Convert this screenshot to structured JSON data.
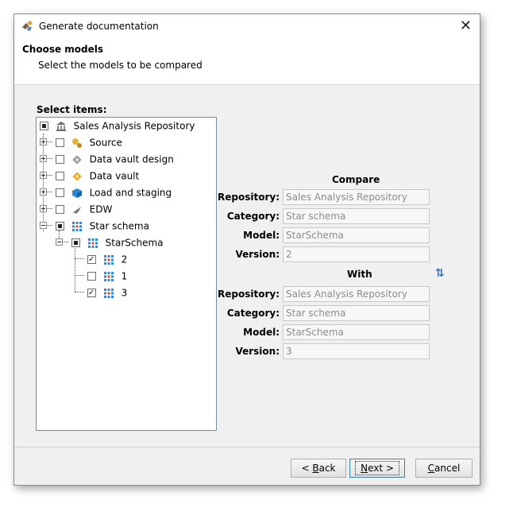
{
  "window": {
    "title": "Generate documentation",
    "close_symbol": "✕"
  },
  "header": {
    "title": "Choose models",
    "subtitle": "Select the models to be compared"
  },
  "tree": {
    "label": "Select items:",
    "root": "Sales Analysis Repository",
    "items": [
      {
        "label": "Source",
        "icon": "source-icon"
      },
      {
        "label": "Data vault design",
        "icon": "data-vault-design-icon"
      },
      {
        "label": "Data vault",
        "icon": "data-vault-icon"
      },
      {
        "label": "Load and staging",
        "icon": "load-staging-icon"
      },
      {
        "label": "EDW",
        "icon": "edw-icon"
      },
      {
        "label": "Star schema",
        "icon": "star-schema-icon"
      }
    ],
    "model": "StarSchema",
    "versions": [
      "2",
      "1",
      "3"
    ]
  },
  "compare": {
    "title": "Compare",
    "repository_label": "Repository:",
    "category_label": "Category:",
    "model_label": "Model:",
    "version_label": "Version:",
    "repository": "Sales Analysis Repository",
    "category": "Star schema",
    "model": "StarSchema",
    "version": "2"
  },
  "with": {
    "title": "With",
    "repository_label": "Repository:",
    "category_label": "Category:",
    "model_label": "Model:",
    "version_label": "Version:",
    "repository": "Sales Analysis Repository",
    "category": "Star schema",
    "model": "StarSchema",
    "version": "3",
    "swap_icon": "⇅"
  },
  "buttons": {
    "back_prefix": "< ",
    "back_mnemonic": "B",
    "back_rest": "ack",
    "next_mnemonic": "N",
    "next_rest": "ext >",
    "cancel_mnemonic": "C",
    "cancel_rest": "ancel"
  }
}
